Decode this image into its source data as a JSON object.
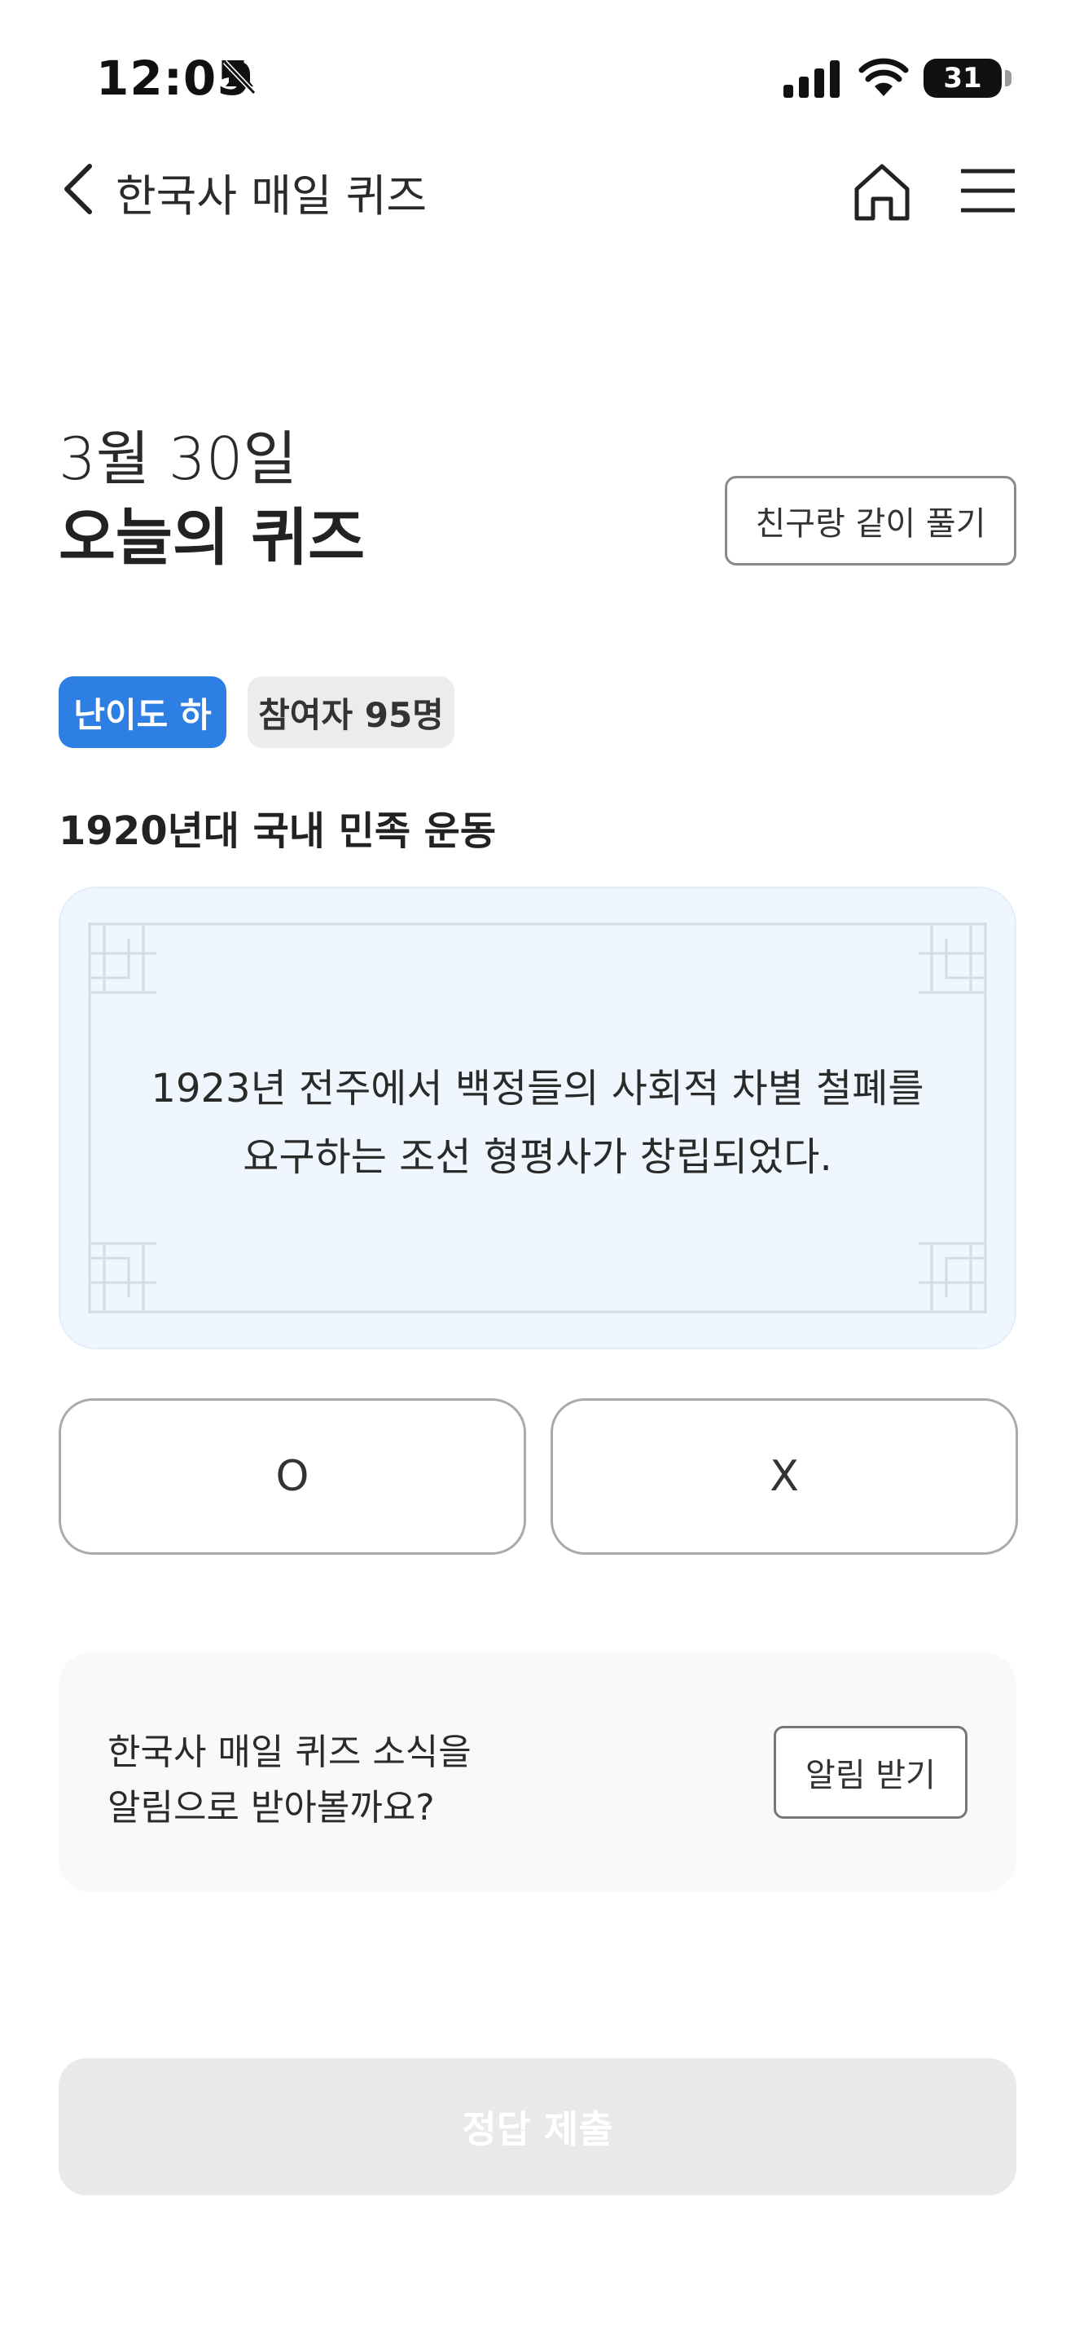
{
  "status_bar": {
    "time": "12:05",
    "battery": "31",
    "icons": [
      "bell-off-icon",
      "signal-icon",
      "wifi-icon",
      "battery-icon"
    ]
  },
  "header": {
    "title": "한국사 매일 퀴즈",
    "icons": [
      "chevron-left-icon",
      "home-icon",
      "menu-icon"
    ]
  },
  "quiz": {
    "date": "3월 30일",
    "heading": "오늘의 퀴즈",
    "friend_button": "친구랑 같이 풀기",
    "level_badge": "난이도 하",
    "participants_badge": "참여자 95명",
    "topic": "1920년대 국내 민족 운동",
    "question_lines": [
      "1923년 전주에서 백정들의 사회적 차별 철폐를",
      "요구하는 조선 형평사가 창립되었다."
    ],
    "answers": [
      "O",
      "X"
    ],
    "submit_label": "정답 제출"
  },
  "notification": {
    "lines": [
      "한국사 매일 퀴즈 소식을",
      "알림으로 받아볼까요?"
    ],
    "button": "알림 받기"
  },
  "colors": {
    "accent": "#2d7fe3",
    "card_bg": "#eff6fe",
    "submit_disabled": "#e9e9e9"
  }
}
